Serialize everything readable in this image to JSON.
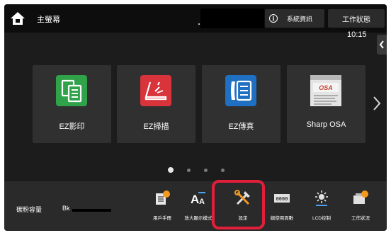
{
  "header": {
    "home_label": "主螢幕",
    "system_info_label": "系統資訊",
    "job_status_label": "工作狀態",
    "time": "10:15"
  },
  "apps": [
    {
      "label": "EZ影印",
      "icon": "copy-icon",
      "color": "#2fa24a"
    },
    {
      "label": "EZ掃描",
      "icon": "scan-icon",
      "color": "#d9333b"
    },
    {
      "label": "EZ傳真",
      "icon": "fax-icon",
      "color": "#1f6fc2"
    },
    {
      "label": "Sharp OSA",
      "icon": "sharp-osa-icon",
      "color": "#c6422e"
    }
  ],
  "pager": {
    "pages": 4,
    "current": 1
  },
  "footer": {
    "toner_label": "碳粉容量",
    "toner_color": "Bk",
    "shortcuts": [
      {
        "label": "用戶手冊",
        "icon": "user-manual-icon"
      },
      {
        "label": "放大顯示模式",
        "icon": "enlarge-display-icon"
      },
      {
        "label": "設定",
        "icon": "settings-icon"
      },
      {
        "label": "總使用頁數",
        "icon": "total-count-icon"
      },
      {
        "label": "LCD控制",
        "icon": "lcd-control-icon"
      },
      {
        "label": "工作狀況",
        "icon": "job-status-icon"
      }
    ]
  },
  "colors": {
    "highlight": "#e11f3a",
    "background": "#1c1c1c",
    "tile": "#303030"
  }
}
